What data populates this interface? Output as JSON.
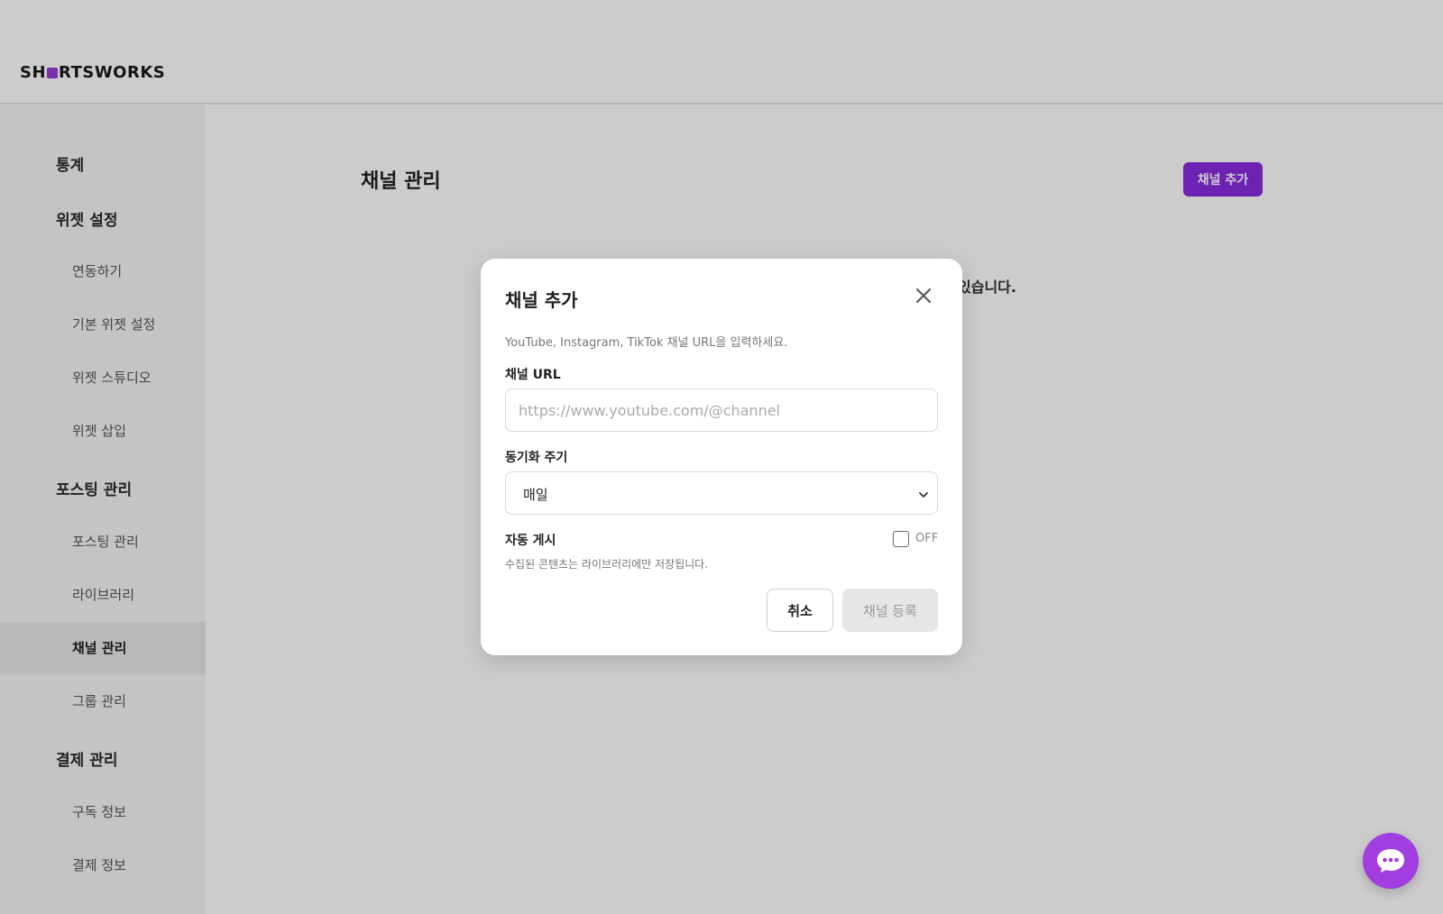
{
  "header": {
    "logo_text_1": "SH",
    "logo_text_2": "RTSWORKS"
  },
  "sidebar": {
    "sections": [
      {
        "label": "통계"
      },
      {
        "label": "위젯 설정"
      },
      {
        "label": "포스팅 관리"
      },
      {
        "label": "결제 관리"
      }
    ],
    "items": [
      {
        "label": "연동하기"
      },
      {
        "label": "기본 위젯 설정"
      },
      {
        "label": "위젯 스튜디오"
      },
      {
        "label": "위젯 삽입"
      },
      {
        "label": "포스팅 관리"
      },
      {
        "label": "라이브러리"
      },
      {
        "label": "채널 관리"
      },
      {
        "label": "그룹 관리"
      },
      {
        "label": "구독 정보"
      },
      {
        "label": "결제 정보"
      }
    ]
  },
  "main": {
    "title": "채널 관리",
    "add_button": "채널 추가",
    "background_text": "있습니다."
  },
  "modal": {
    "title": "채널 추가",
    "description": "YouTube, Instagram, TikTok 채널 URL을 입력하세요.",
    "url_label": "채널 URL",
    "url_placeholder": "https://www.youtube.com/@channel",
    "sync_label": "동기화 주기",
    "sync_value": "매일",
    "auto_post_label": "자동 게시",
    "auto_post_state": "OFF",
    "auto_post_helper": "수집된 콘텐츠는 라이브러리에만 저장됩니다.",
    "cancel_label": "취소",
    "submit_label": "채널 등록"
  },
  "colors": {
    "accent": "#8a2be2",
    "chat": "#a23de0"
  },
  "icons": {
    "close": "close-icon",
    "chevron": "chevron-down-icon",
    "chat": "chat-bubble-icon"
  }
}
